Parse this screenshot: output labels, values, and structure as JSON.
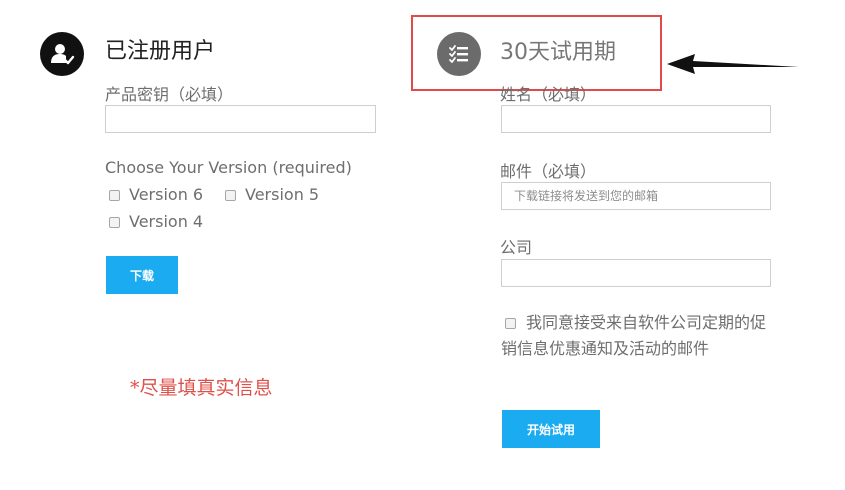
{
  "registered": {
    "title": "已注册用户",
    "icon": "user-check-icon",
    "product_key_label": "产品密钥（必填）",
    "product_key_value": "",
    "version_label": "Choose Your Version (required)",
    "versions": [
      "Version 6",
      "Version 5",
      "Version 4"
    ],
    "download_button": "下载",
    "note": "*尽量填真实信息"
  },
  "trial": {
    "title": "30天试用期",
    "icon": "checklist-icon",
    "name_label": "姓名（必填）",
    "name_value": "",
    "email_label": "邮件（必填）",
    "email_placeholder": "下载链接将发送到您的邮箱",
    "company_label": "公司",
    "company_value": "",
    "agree_text": "我同意接受来自软件公司定期的促销信息优惠通知及活动的邮件",
    "start_button": "开始试用"
  },
  "colors": {
    "accent": "#1aabf0",
    "highlight": "#e04a4a",
    "note": "#e0504b"
  }
}
